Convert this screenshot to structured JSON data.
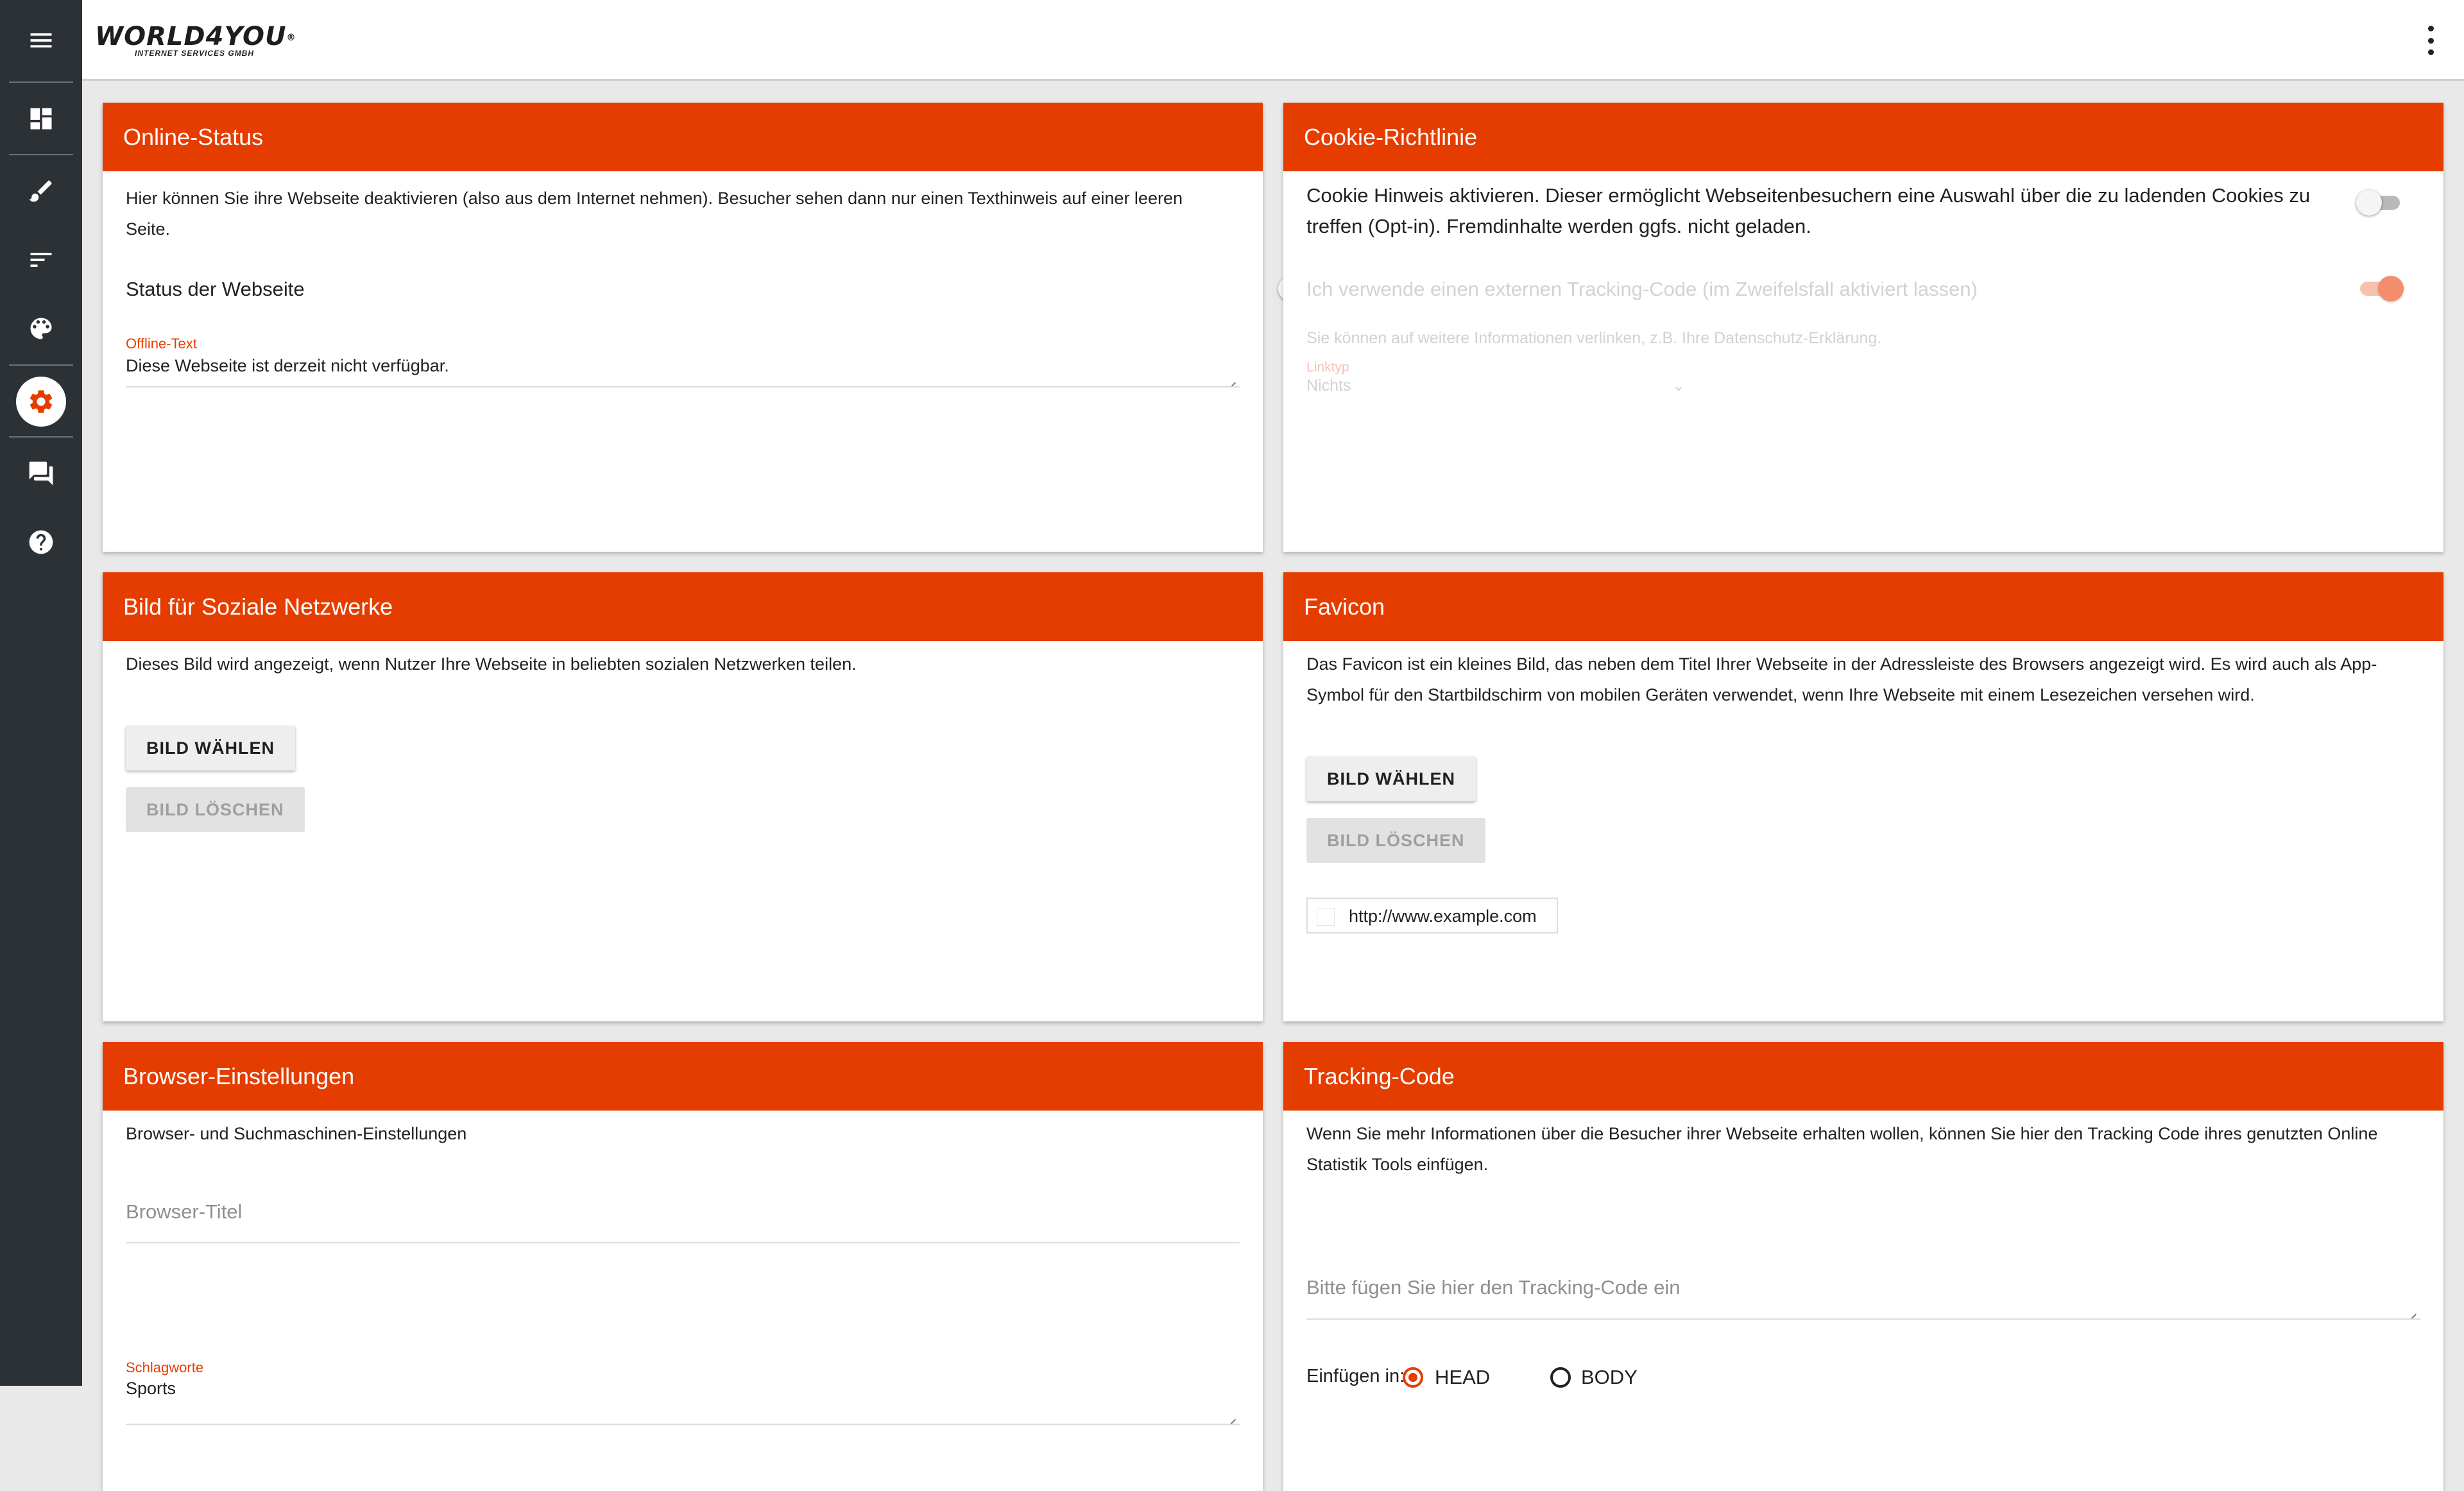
{
  "app": {
    "logo_main": "WORLD4YOU",
    "logo_reg": "®",
    "logo_sub": "INTERNET SERVICES GMBH"
  },
  "sidebar": {
    "items": [
      {
        "icon": "menu-icon"
      },
      {
        "icon": "dashboard-icon"
      },
      {
        "icon": "brush-icon"
      },
      {
        "icon": "sort-icon"
      },
      {
        "icon": "palette-icon"
      },
      {
        "icon": "gear-icon",
        "active": true
      },
      {
        "icon": "forum-icon"
      },
      {
        "icon": "help-icon"
      }
    ],
    "accent": "#e53d00"
  },
  "cards": {
    "online_status": {
      "title": "Online-Status",
      "desc": "Hier können Sie ihre Webseite deaktivieren (also aus dem Internet nehmen). Besucher sehen dann nur einen Texthinweis auf einer leeren Seite.",
      "status_label": "Status der Webseite",
      "status_on": false,
      "offline_label": "Offline-Text",
      "offline_value": "Diese Webseite ist derzeit nicht verfügbar."
    },
    "cookie": {
      "title": "Cookie-Richtlinie",
      "desc": "Cookie Hinweis aktivieren. Dieser ermöglicht Webseitenbesuchern eine Auswahl über die zu ladenden Cookies zu treffen (Opt-in). Fremdinhalte werden ggfs. nicht geladen.",
      "cookie_on": false,
      "tracking_label": "Ich verwende einen externen Tracking-Code (im Zweifelsfall aktiviert lassen)",
      "tracking_on": true,
      "link_info": "Sie können auf weitere Informationen verlinken, z.B. Ihre Datenschutz-Erklärung.",
      "linktyp_label": "Linktyp",
      "linktyp_value": "Nichts"
    },
    "social": {
      "title": "Bild für Soziale Netzwerke",
      "desc": "Dieses Bild wird angezeigt, wenn Nutzer Ihre Webseite in beliebten sozialen Netzwerken teilen.",
      "choose": "BILD WÄHLEN",
      "delete": "BILD LÖSCHEN"
    },
    "favicon": {
      "title": "Favicon",
      "desc": "Das Favicon ist ein kleines Bild, das neben dem Titel Ihrer Webseite in der Adressleiste des Browsers angezeigt wird. Es wird auch als App-Symbol für den Startbildschirm von mobilen Geräten verwendet, wenn Ihre Webseite mit einem Lesezeichen versehen wird.",
      "choose": "BILD WÄHLEN",
      "delete": "BILD LÖSCHEN",
      "preview_url": "http://www.example.com"
    },
    "browser": {
      "title": "Browser-Einstellungen",
      "desc": "Browser- und Suchmaschinen-Einstellungen",
      "title_placeholder": "Browser-Titel",
      "keywords_label": "Schlagworte",
      "keywords_value": "Sports"
    },
    "tracking": {
      "title": "Tracking-Code",
      "desc": "Wenn Sie mehr Informationen über die Besucher ihrer Webseite erhalten wollen, können Sie hier den Tracking Code ihres genutzten Online Statistik Tools einfügen.",
      "placeholder": "Bitte fügen Sie hier den Tracking-Code ein",
      "insert_label": "Einfügen in:",
      "options": [
        "HEAD",
        "BODY"
      ],
      "selected": "HEAD"
    }
  }
}
